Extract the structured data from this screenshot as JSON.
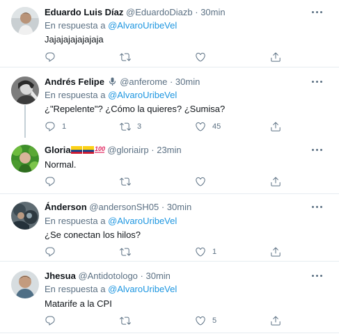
{
  "tweets": [
    {
      "name": "Eduardo Luis Díaz",
      "handle": "@EduardoDiazb",
      "time": "· 30min",
      "reply_prefix": "En respuesta a ",
      "reply_to": "@AlvaroUribeVel",
      "text": "Jajajajajajajaja",
      "reply_count": "",
      "retweet_count": "",
      "like_count": ""
    },
    {
      "name": "Andrés Felipe",
      "badge_icon": "microphone-icon",
      "handle": "@anferome",
      "time": "· 30min",
      "reply_prefix": "En respuesta a ",
      "reply_to": "@AlvaroUribeVel",
      "text": "¿\"Repelente\"? ¿Cómo la quieres? ¿Sumisa?",
      "reply_count": "1",
      "retweet_count": "3",
      "like_count": "45"
    },
    {
      "name": "Gloria",
      "badge_icons": [
        "colombia-flag-icon",
        "colombia-flag-icon",
        "hundred-points-icon"
      ],
      "handle": "@gloriairp",
      "time": "· 23min",
      "text": "Normal.",
      "reply_count": "",
      "retweet_count": "",
      "like_count": ""
    },
    {
      "name": "Ánderson",
      "handle": "@andersonSH05",
      "time": "· 30min",
      "reply_prefix": "En respuesta a ",
      "reply_to": "@AlvaroUribeVel",
      "text": "¿Se conectan los hilos?",
      "reply_count": "",
      "retweet_count": "",
      "like_count": "1"
    },
    {
      "name": "Jhesua",
      "handle": "@Antidotologo",
      "time": "· 30min",
      "reply_prefix": "En respuesta a ",
      "reply_to": "@AlvaroUribeVel",
      "text": "Matarife a la CPI",
      "reply_count": "",
      "retweet_count": "",
      "like_count": "5"
    }
  ],
  "icons": {
    "reply": "reply-icon",
    "retweet": "retweet-icon",
    "like": "heart-icon",
    "share": "share-icon",
    "more": "more-icon"
  },
  "colors": {
    "mention": "#1b95e0",
    "secondary_text": "#5b7083",
    "divider": "#e6ecf0",
    "thread_line": "#c4cfd6"
  }
}
